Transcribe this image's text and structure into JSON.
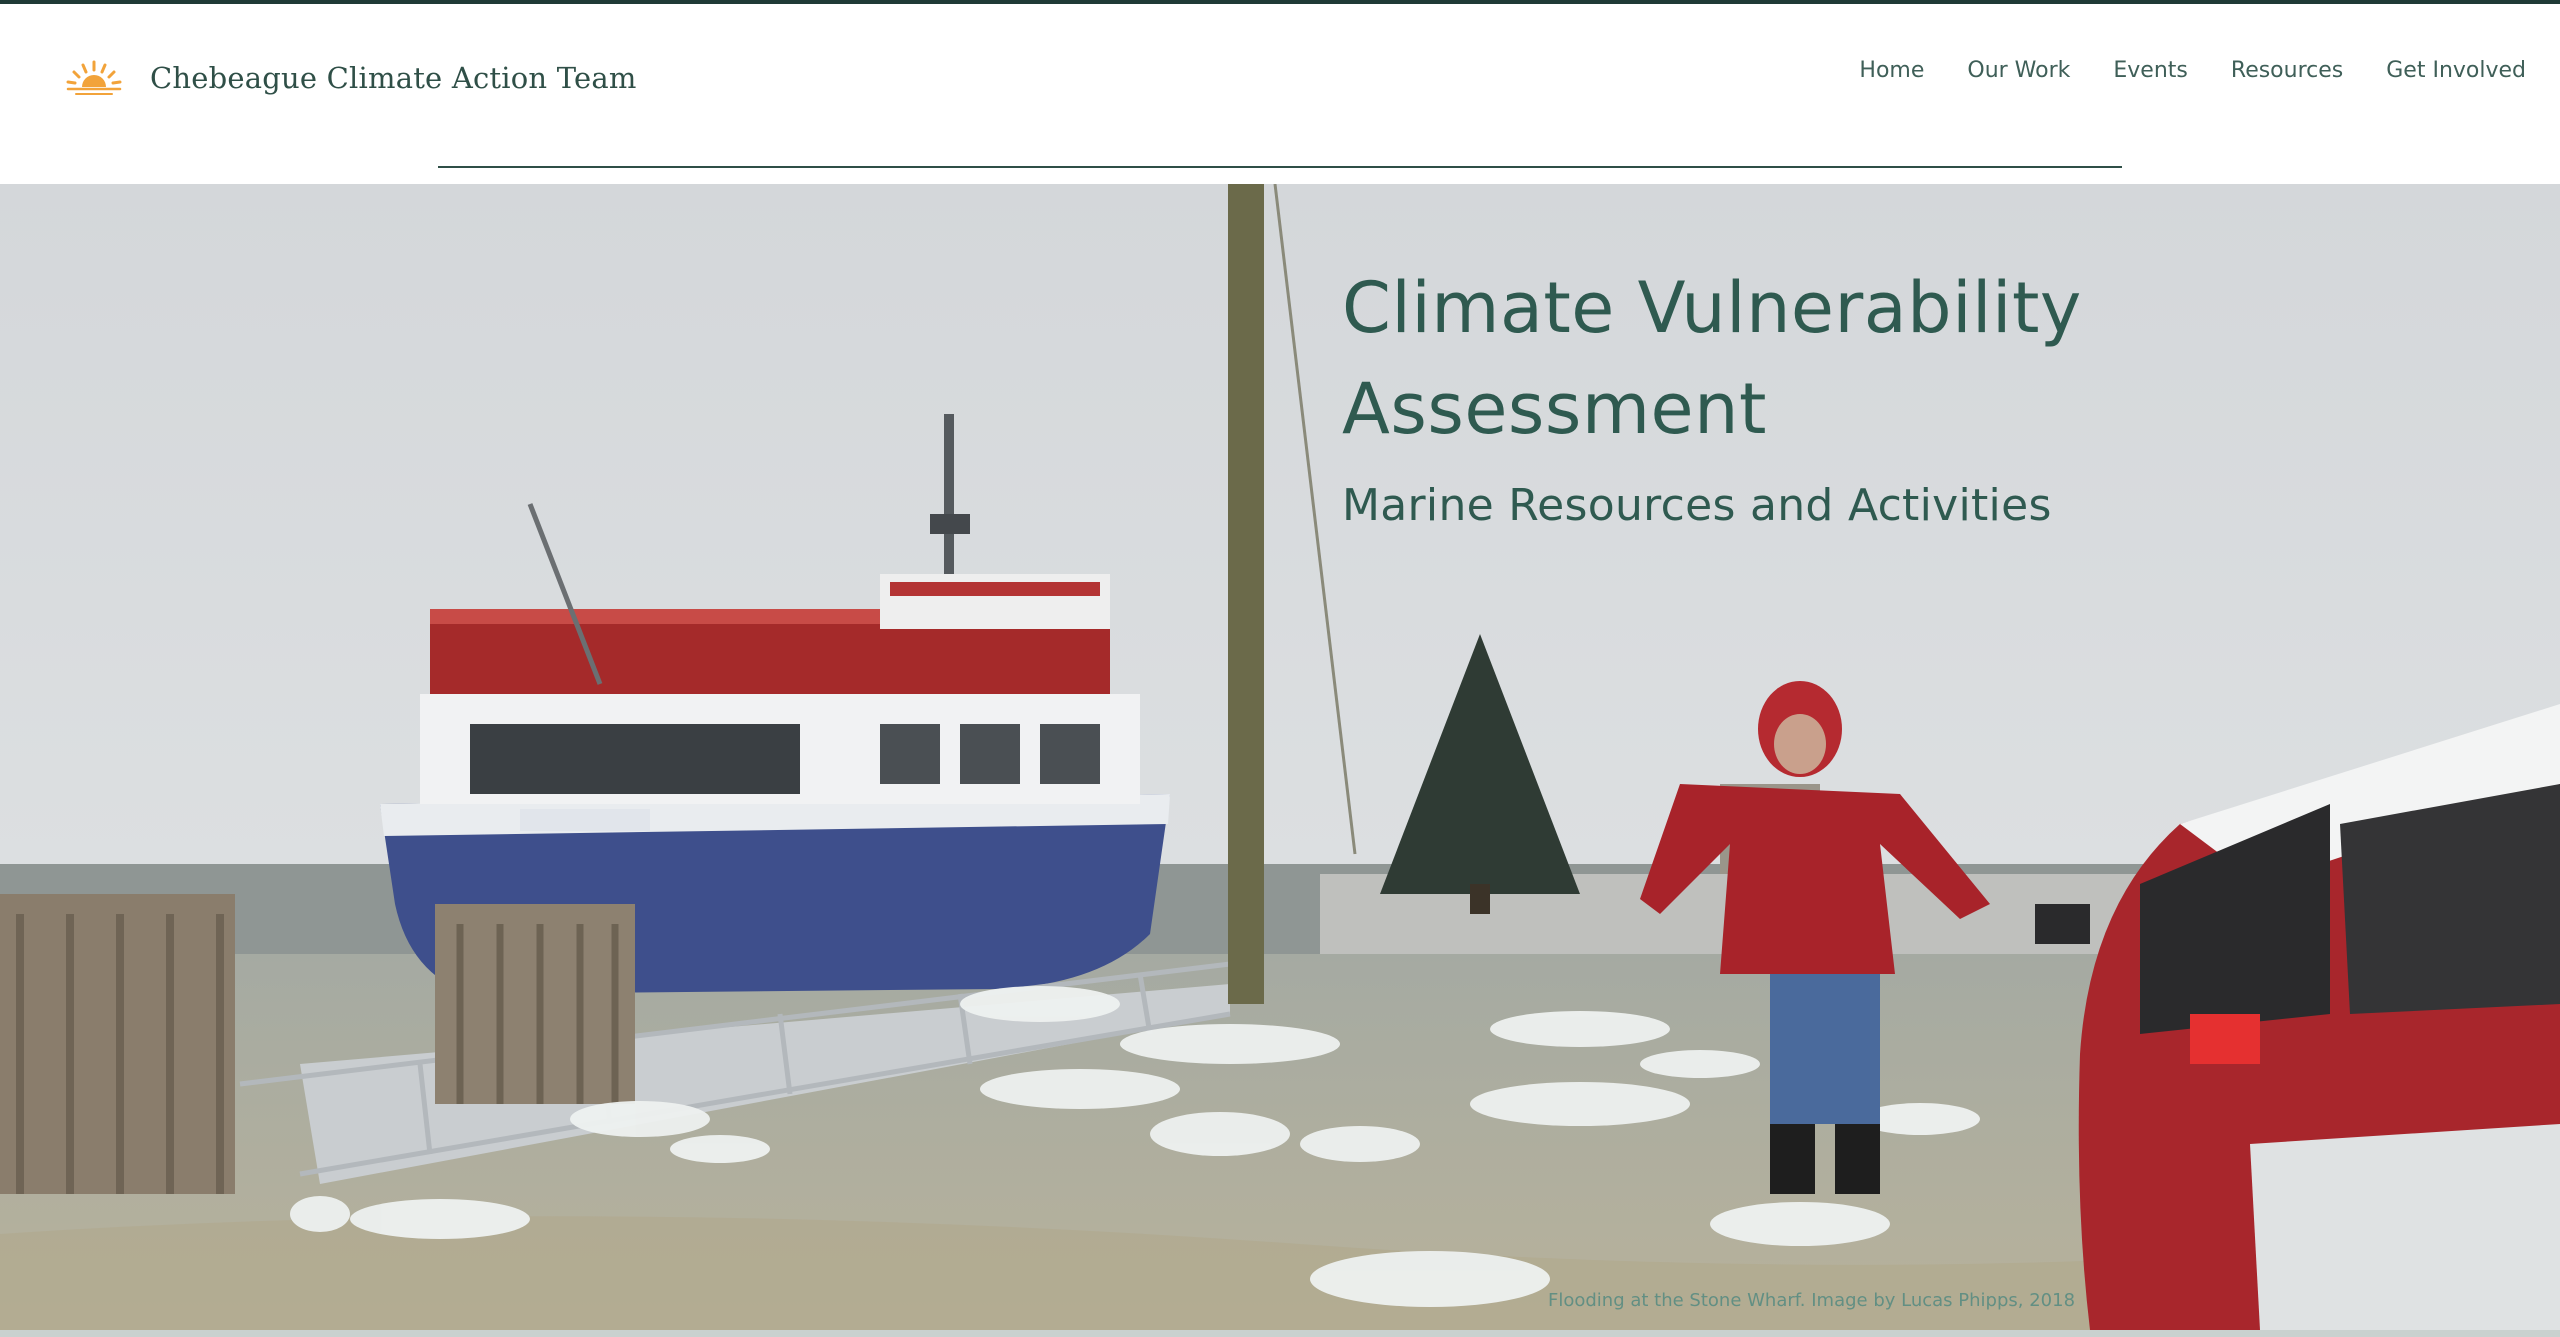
{
  "site": {
    "name": "Chebeague Climate Action Team",
    "logo_icon": "rising-sun-icon",
    "logo_color": "#f2a33a",
    "text_color": "#2f4f47"
  },
  "nav": {
    "items": [
      {
        "label": "Home"
      },
      {
        "label": "Our Work"
      },
      {
        "label": "Events"
      },
      {
        "label": "Resources"
      },
      {
        "label": "Get Involved"
      }
    ]
  },
  "hero": {
    "title": "Climate Vulnerability Assessment",
    "subtitle": "Marine Resources and Activities",
    "caption": "Flooding at the Stone Wharf. Image by Lucas Phipps, 2018"
  }
}
